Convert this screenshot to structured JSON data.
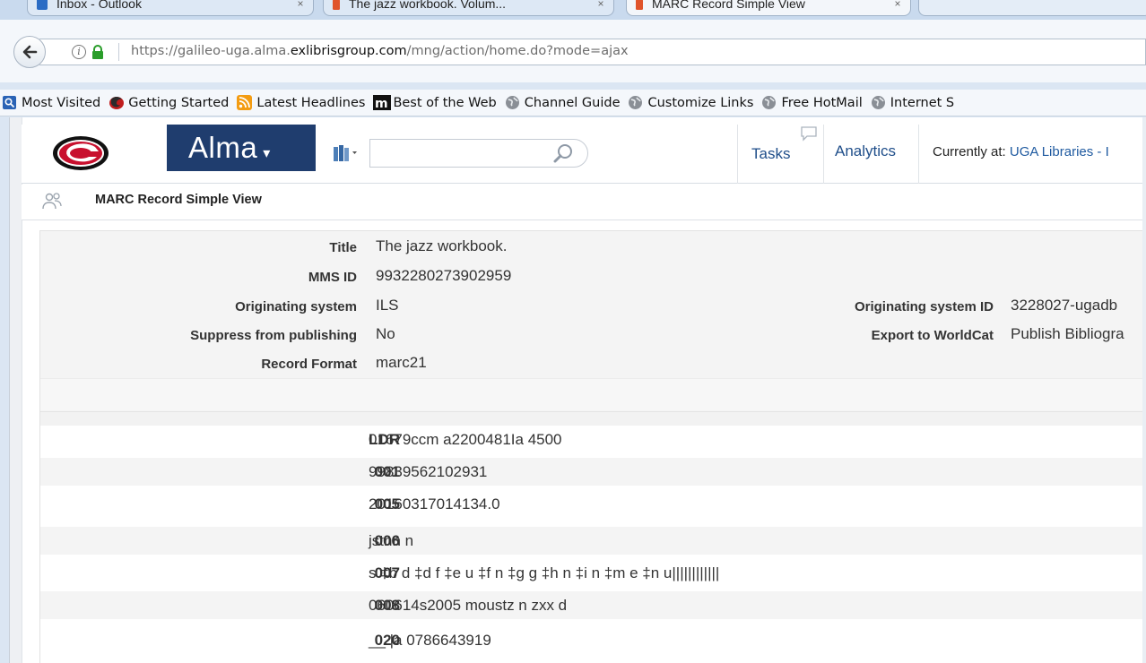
{
  "browser": {
    "tabs": [
      {
        "title": "Inbox - Outlook",
        "close": "×"
      },
      {
        "title": "The jazz workbook. Volum...",
        "close": "×"
      },
      {
        "title": "MARC Record Simple View",
        "close": "×"
      }
    ],
    "url": {
      "prefix": "https://galileo-uga.alma.",
      "domain": "exlibrisgroup.com",
      "path": "/mng/action/home.do?mode=ajax"
    },
    "bookmarks": [
      {
        "label": "Most Visited",
        "icon": "search-page-icon"
      },
      {
        "label": "Getting Started",
        "icon": "firefox-icon"
      },
      {
        "label": "Latest Headlines",
        "icon": "rss-icon"
      },
      {
        "label": "Best of the Web",
        "icon": "msn-icon"
      },
      {
        "label": "Channel Guide",
        "icon": "globe-icon"
      },
      {
        "label": "Customize Links",
        "icon": "globe-icon"
      },
      {
        "label": "Free HotMail",
        "icon": "globe-icon"
      },
      {
        "label": "Internet S",
        "icon": "globe-icon"
      }
    ]
  },
  "header": {
    "app_name": "Alma",
    "caret": "▾",
    "search_value": "",
    "tasks": "Tasks",
    "analytics": "Analytics",
    "current_prefix": "Currently at:",
    "current_location": "UGA Libraries - I"
  },
  "page": {
    "title": "MARC Record Simple View"
  },
  "record": {
    "title_label": "Title",
    "title": "The jazz workbook.",
    "mms_label": "MMS ID",
    "mms_id": "9932280273902959",
    "orig_sys_label": "Originating system",
    "orig_sys": "ILS",
    "suppress_label": "Suppress from publishing",
    "suppress": "No",
    "format_label": "Record Format",
    "format": "marc21",
    "orig_sys_id_label": "Originating system ID",
    "orig_sys_id": "3228027-ugadb",
    "worldcat_label": "Export to WorldCat",
    "worldcat": "Publish Bibliogra"
  },
  "marc_fields": [
    {
      "tag": "LDR",
      "value": "01679ccm a2200481Ia 4500"
    },
    {
      "tag": "001",
      "value": "99839562102931"
    },
    {
      "tag": "005",
      "value": "20160317014134.0"
    },
    {
      "tag": "006",
      "value": "jstnn n"
    },
    {
      "tag": "007",
      "value": "s ‡b d ‡d f ‡e u ‡f n ‡g g ‡h n ‡i n ‡m e ‡n u||||||||||||"
    },
    {
      "tag": "008",
      "value": "060614s2005 moustz n zxx d"
    },
    {
      "tag": "020",
      "value": "__ |a 0786643919"
    }
  ],
  "colors": {
    "alma_blue": "#1f3d6e",
    "link_blue": "#1f4e8a",
    "uga_red": "#c8102e"
  }
}
